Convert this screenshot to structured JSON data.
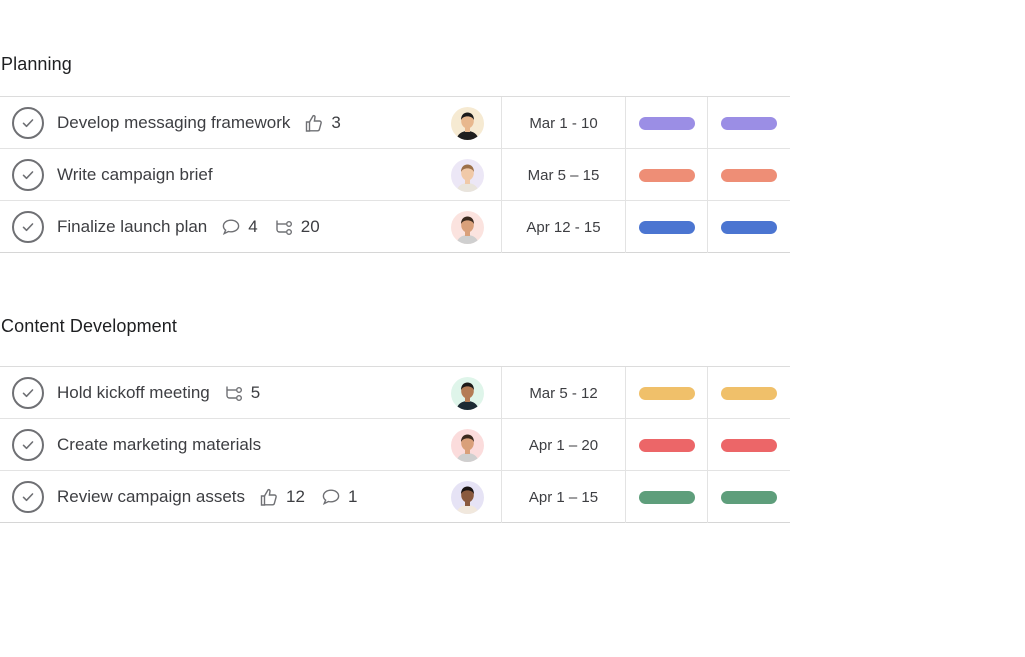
{
  "sections": [
    {
      "title": "Planning",
      "rows": [
        {
          "name": "Develop messaging framework",
          "meta": [
            {
              "icon": "thumbs-up-icon",
              "value": "3"
            }
          ],
          "avatar": "avatar-asian-man",
          "date": "Mar 1 - 10",
          "color": "#9b8ee5"
        },
        {
          "name": "Write campaign brief",
          "meta": [],
          "avatar": "avatar-woman-long-hair",
          "date": "Mar 5 – 15",
          "color": "#ee8e76"
        },
        {
          "name": "Finalize launch plan",
          "meta": [
            {
              "icon": "comment-icon",
              "value": "4"
            },
            {
              "icon": "subtask-icon",
              "value": "20"
            }
          ],
          "avatar": "avatar-man-smiling",
          "date": "Apr 12 - 15",
          "color": "#4b75d1"
        }
      ]
    },
    {
      "title": "Content Development",
      "rows": [
        {
          "name": "Hold kickoff meeting",
          "meta": [
            {
              "icon": "subtask-icon",
              "value": "5"
            }
          ],
          "avatar": "avatar-man-beard",
          "date": "Mar 5 - 12",
          "color": "#f0c06a"
        },
        {
          "name": "Create marketing materials",
          "meta": [],
          "avatar": "avatar-man-smiling-2",
          "date": "Apr 1 – 20",
          "color": "#ec6668"
        },
        {
          "name": "Review campaign assets",
          "meta": [
            {
              "icon": "thumbs-up-icon",
              "value": "12"
            },
            {
              "icon": "comment-icon",
              "value": "1"
            }
          ],
          "avatar": "avatar-woman-dark-hair",
          "date": "Apr 1 – 15",
          "color": "#5e9e7b"
        }
      ]
    }
  ]
}
